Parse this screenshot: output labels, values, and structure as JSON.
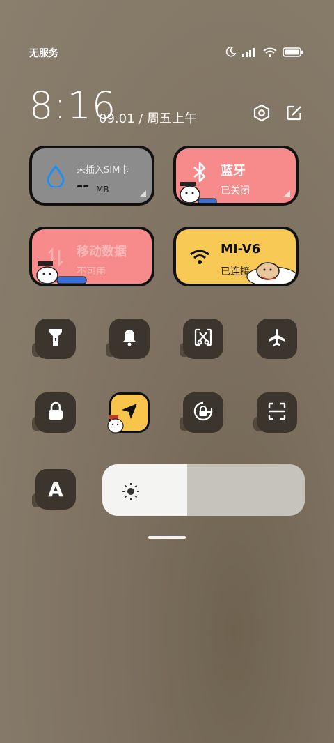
{
  "status_bar": {
    "carrier": "无服务",
    "icons": [
      "moon-icon",
      "signal-icon",
      "wifi-icon",
      "battery-icon"
    ]
  },
  "header": {
    "time": "8:16",
    "date": "09.01 / 周五上午",
    "icons": [
      "settings-icon",
      "edit-icon"
    ]
  },
  "tiles": {
    "sim": {
      "title": "未插入SIM卡",
      "value": "--",
      "unit": "MB",
      "icon": "water-drop-icon",
      "color": "#8c8c8c"
    },
    "bluetooth": {
      "title": "蓝牙",
      "subtitle": "已关闭",
      "icon": "bluetooth-icon",
      "color": "#f78a8a"
    },
    "mobile_data": {
      "title": "移动数据",
      "subtitle": "不可用",
      "icon": "data-arrows-icon",
      "color": "#f78a8a"
    },
    "wifi": {
      "title": "MI-V6",
      "subtitle": "已连接",
      "icon": "wifi-icon",
      "color": "#f8c955"
    }
  },
  "toggles_row1": [
    "flashlight-icon",
    "bell-icon",
    "screenshot-icon",
    "airplane-icon"
  ],
  "toggles_row2": [
    "lock-icon",
    "location-icon",
    "rotation-lock-icon",
    "scan-icon"
  ],
  "reading_mode_label": "A",
  "brightness": {
    "level": 0.42,
    "icon": "sun-icon"
  }
}
